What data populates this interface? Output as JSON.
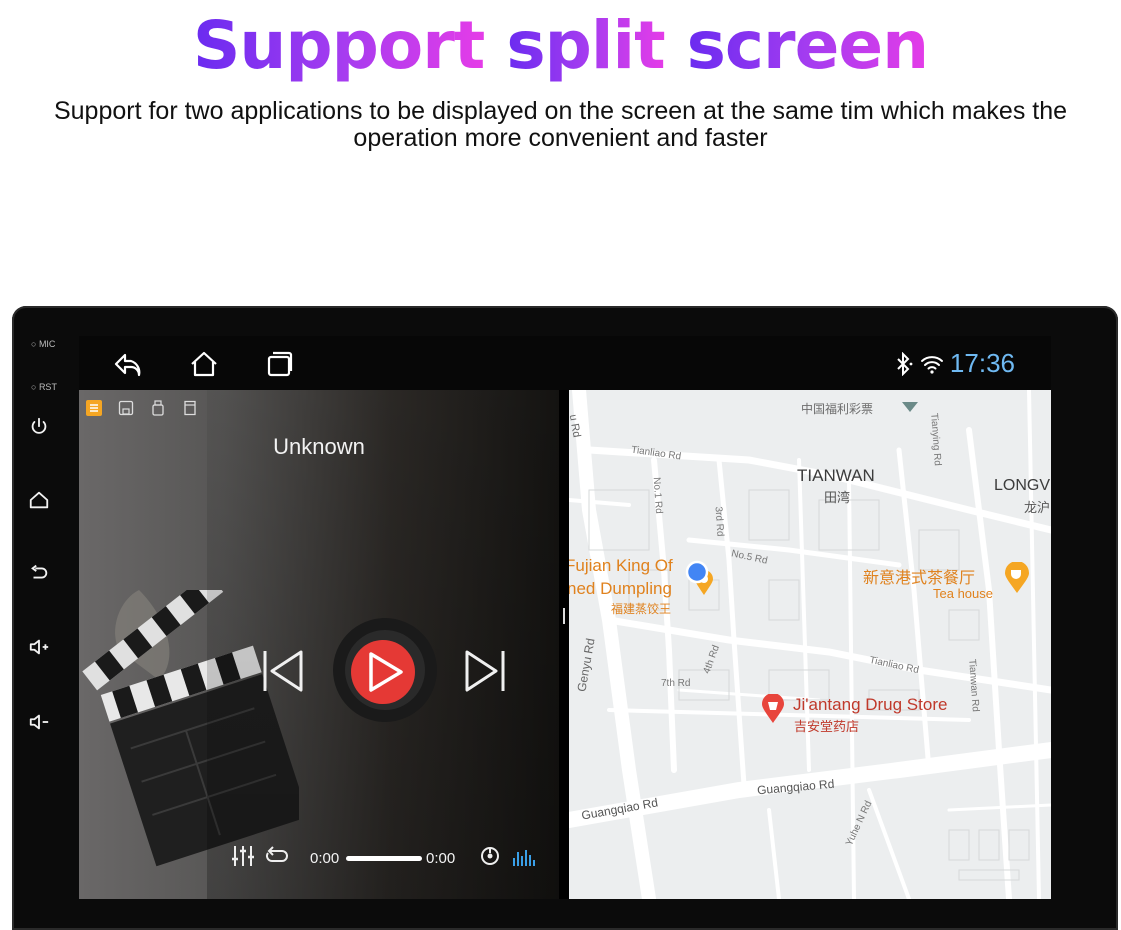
{
  "headline": {
    "word1": "Support",
    "word2": "split",
    "word3": "screen"
  },
  "description": {
    "line1": "Support for two applications to be displayed on the screen at the same tim which makes the",
    "line2": "operation more convenient and faster"
  },
  "device": {
    "mic_label": "MIC",
    "rst_label": "RST",
    "side_buttons": [
      "power-icon",
      "home-icon",
      "back-icon",
      "volume-up-icon",
      "volume-down-icon"
    ]
  },
  "navbar": {
    "icons": [
      "back-icon",
      "home-icon",
      "recent-apps-icon"
    ],
    "status_icons": [
      "bluetooth-icon",
      "wifi-icon"
    ],
    "clock": "17:36"
  },
  "music": {
    "title": "Unknown",
    "tool_icons": [
      "playlist-icon",
      "save-icon",
      "usb-icon",
      "sd-card-icon"
    ],
    "time_current": "0:00",
    "time_total": "0:00",
    "progress": 1.0,
    "accent": "#e53935"
  },
  "map": {
    "poi_top": "中国福利彩票",
    "district_en": "TIANWAN",
    "district_cn": "田湾",
    "edge_en": "LONGV",
    "edge_cn": "龙沪",
    "poi_dumpling_1": "Fujian King Of",
    "poi_dumpling_2": "ned Dumpling",
    "poi_dumpling_cn": "福建蒸饺王",
    "poi_tea_cn": "新意港式茶餐厅",
    "poi_tea_en": "Tea house",
    "poi_drug_en": "Ji'antang Drug Store",
    "poi_drug_cn": "吉安堂药店",
    "roads": {
      "tianliao_top": "Tianliao Rd",
      "tianliao_right": "Tianliao Rd",
      "no1": "No.1 Rd",
      "rd3": "3rd Rd",
      "no5": "No.5 Rd",
      "genyu": "Genyu Rd",
      "rd4": "4th Rd",
      "rd7": "7th Rd",
      "guangqiao_left": "Guangqiao Rd",
      "guangqiao_right": "Guangqiao Rd",
      "tianying": "Tianying Rd",
      "tianwan": "Tianwan Rd",
      "yuhe": "Yuhe N Rd",
      "edge_rd": "u Rd"
    },
    "colors": {
      "poi_orange": "#f5a623",
      "poi_red": "#e8453c",
      "location_blue": "#4285f4",
      "label_orange": "#e0821e"
    }
  }
}
